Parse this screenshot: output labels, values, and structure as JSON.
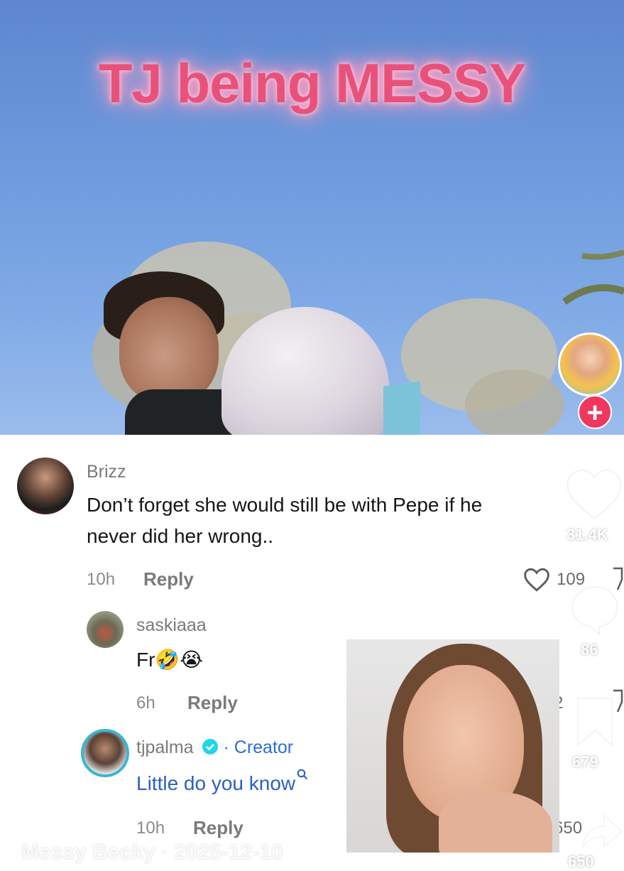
{
  "video": {
    "title_overlay": "TJ being MESSY"
  },
  "profile": {
    "follow_icon": "plus-icon"
  },
  "sidebar": {
    "likes_count": "31.4K",
    "comments_count": "86",
    "saves_count": "679",
    "shares_count": "650"
  },
  "comments": [
    {
      "username": "Brizz",
      "text_line1": "Don’t forget she would still be with Pepe if he",
      "text_line2": "never did her wrong..",
      "time": "10h",
      "reply_label": "Reply",
      "likes": "109"
    },
    {
      "username": "saskiaaa",
      "text": "Fr🤣😭",
      "time": "6h",
      "reply_label": "Reply",
      "likes": "2"
    },
    {
      "username": "tjpalma",
      "creator_label": "· Creator",
      "text": "Little do you know",
      "time": "10h",
      "reply_label": "Reply",
      "likes": "650"
    }
  ],
  "watermark": "Messy Becky · 2025-12-10",
  "colors": {
    "accent_pink": "#e8527a",
    "follow_red": "#f0375d",
    "creator_blue": "#2b6bd6"
  }
}
